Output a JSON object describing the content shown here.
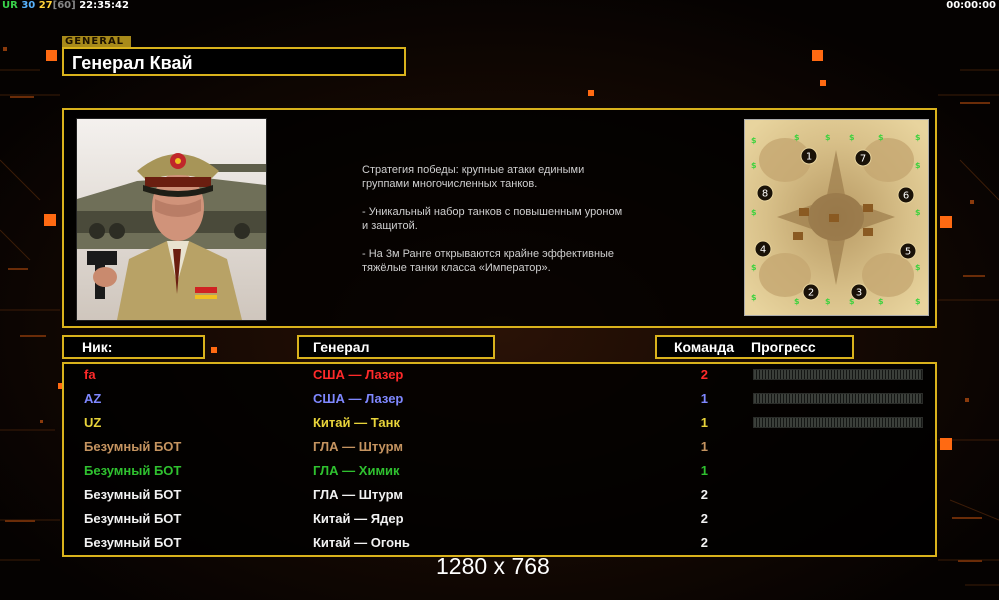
{
  "topbar": {
    "ur": "UR",
    "n30": "30",
    "n27": "27",
    "n60": "[60]",
    "clock": "22:35:42",
    "timer": "00:00:00"
  },
  "general": {
    "tag": "GENERAL",
    "name": "Генерал Квай"
  },
  "description": [
    "Стратегия победы: крупные атаки едиными\n группами многочисленных танков.",
    "- Уникальный набор танков с повышенным уроном\n и защитой.",
    "- На 3м Ранге открываются крайне эффективные\n тяжёлые танки класса «Император»."
  ],
  "columns": {
    "nick": "Ник:",
    "general": "Генерал",
    "team": "Команда",
    "progress": "Прогресс"
  },
  "colors": {
    "accent": "#d9b21c"
  },
  "players": [
    {
      "nick": "fa",
      "general": "США — Лазер",
      "team": "2",
      "color": "#ff2a2a",
      "progress": 0
    },
    {
      "nick": "AZ",
      "general": "США — Лазер",
      "team": "1",
      "color": "#7f88ff",
      "progress": 0
    },
    {
      "nick": "UZ",
      "general": "Китай — Танк",
      "team": "1",
      "color": "#e8d43a",
      "progress": 0
    },
    {
      "nick": "Безумный БОТ",
      "general": "ГЛА — Штурм",
      "team": "1",
      "color": "#c59460"
    },
    {
      "nick": "Безумный БОТ",
      "general": "ГЛА — Химик",
      "team": "1",
      "color": "#2fc12f"
    },
    {
      "nick": "Безумный БОТ",
      "general": "ГЛА — Штурм",
      "team": "2",
      "color": "#f2f2f2"
    },
    {
      "nick": "Безумный БОТ",
      "general": "Китай — Ядер",
      "team": "2",
      "color": "#f2f2f2"
    },
    {
      "nick": "Безумный БОТ",
      "general": "Китай — Огонь",
      "team": "2",
      "color": "#f2f2f2"
    }
  ],
  "minimap": {
    "slots": [
      "1",
      "2",
      "3",
      "4",
      "5",
      "6",
      "7",
      "8"
    ]
  },
  "resolution": "1280 x 768"
}
